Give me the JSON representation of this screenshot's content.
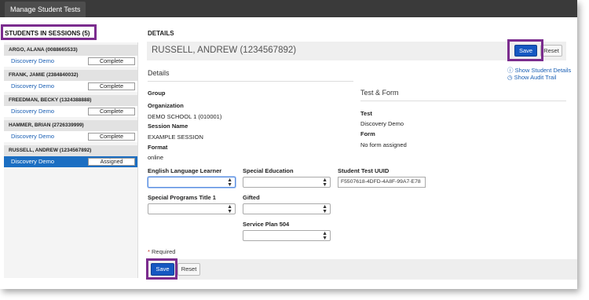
{
  "tab": {
    "label": "Manage Student Tests"
  },
  "left": {
    "title": "STUDENTS IN SESSIONS (5)",
    "students": [
      {
        "name": "ARGO, ALANA (0088665533)",
        "test": "Discovery Demo",
        "status": "Complete",
        "active": false
      },
      {
        "name": "FRANK, JAMIE (2384840032)",
        "test": "Discovery Demo",
        "status": "Complete",
        "active": false
      },
      {
        "name": "FREEDMAN, BECKY (1324388888)",
        "test": "Discovery Demo",
        "status": "Complete",
        "active": false
      },
      {
        "name": "HAMMER, BRIAN (2726339999)",
        "test": "Discovery Demo",
        "status": "Complete",
        "active": false
      },
      {
        "name": "RUSSELL, ANDREW (1234567892)",
        "test": "Discovery Demo",
        "status": "Assigned",
        "active": true
      }
    ]
  },
  "details": {
    "title": "DETAILS",
    "student_name": "RUSSELL, ANDREW (1234567892)",
    "save_label": "Save",
    "reset_label": "Reset",
    "section_title": "Details",
    "links": {
      "show_student_details": "Show Student Details",
      "show_audit_trail": "Show Audit Trail"
    },
    "group_label": "Group",
    "organization_label": "Organization",
    "organization_value": "DEMO SCHOOL 1 (010001)",
    "session_label": "Session Name",
    "session_value": "EXAMPLE SESSION",
    "format_label": "Format",
    "format_value": "online",
    "test_form_title": "Test & Form",
    "test_label": "Test",
    "test_value": "Discovery Demo",
    "form_label": "Form",
    "form_value": "No form assigned",
    "fields": {
      "ell": "English Language Learner",
      "special_ed": "Special Education",
      "uuid": "Student Test UUID",
      "uuid_value": "F5507618-4DFD-4A8F-99A7-E78",
      "title1": "Special Programs Title 1",
      "gifted": "Gifted",
      "sp504": "Service Plan 504"
    },
    "required_star": "*",
    "required_text": "Required",
    "footer_save": "Save",
    "footer_reset": "Reset"
  },
  "colors": {
    "highlight": "#7b2c8e",
    "primary": "#1558c2",
    "link": "#1a5fb4"
  }
}
